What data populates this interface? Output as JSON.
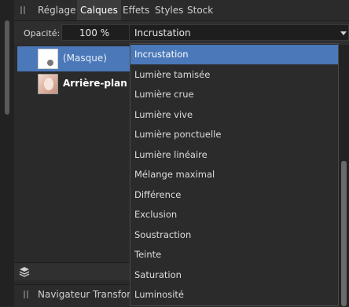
{
  "tabs": [
    "Réglage",
    "Calques",
    "Effets",
    "Styles",
    "Stock"
  ],
  "active_tab": "Calques",
  "controls": {
    "opacity_label": "Opacité:",
    "opacity_value": "100 %",
    "blend_mode_value": "Incrustation"
  },
  "layers": [
    {
      "name": "(Masque)",
      "suffix": "",
      "selected": true
    },
    {
      "name": "Arrière-plan",
      "suffix": "(",
      "selected": false
    }
  ],
  "blend_options": [
    "Incrustation",
    "Lumière tamisée",
    "Lumière crue",
    "Lumière vive",
    "Lumière ponctuelle",
    "Lumière linéaire",
    "Mélange maximal",
    "Différence",
    "Exclusion",
    "Soustraction",
    "Teinte",
    "Saturation",
    "Luminosité"
  ],
  "selected_blend_index": 0,
  "bottom_tabs": [
    "Navigateur",
    "Transfor"
  ],
  "colors": {
    "accent": "#4a78b8",
    "panel": "#2a2a2a",
    "field": "#1e1e1e"
  }
}
